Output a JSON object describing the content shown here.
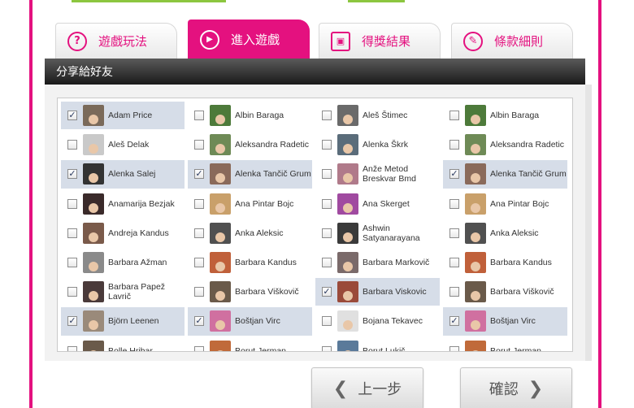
{
  "tabs": [
    {
      "label": "遊戲玩法",
      "icon": "question-icon",
      "glyph": "?"
    },
    {
      "label": "進入遊戲",
      "icon": "play-icon",
      "glyph": "▶",
      "active": true
    },
    {
      "label": "得獎結果",
      "icon": "gift-icon",
      "glyph": "▣"
    },
    {
      "label": "條款細則",
      "icon": "pencil-icon",
      "glyph": "✎"
    }
  ],
  "panel": {
    "title": "分享給好友"
  },
  "friends": [
    {
      "name": "Adam Price",
      "checked": true,
      "color": "#7a6a5a"
    },
    {
      "name": "Albin Baraga",
      "checked": false,
      "color": "#4d7a3a"
    },
    {
      "name": "Aleš Štimec",
      "checked": false,
      "color": "#6a6a6a"
    },
    {
      "name": "Albin Baraga",
      "checked": false,
      "color": "#4d7a3a"
    },
    {
      "name": "Aleš Delak",
      "checked": false,
      "color": "#c9c9c9"
    },
    {
      "name": "Aleksandra Radetic",
      "checked": false,
      "color": "#6e8a56"
    },
    {
      "name": "Alenka Škrk",
      "checked": false,
      "color": "#5a6c7a"
    },
    {
      "name": "Aleksandra Radetic",
      "checked": false,
      "color": "#6e8a56"
    },
    {
      "name": "Alenka Salej",
      "checked": true,
      "color": "#333333"
    },
    {
      "name": "Alenka Tančič Grum",
      "checked": true,
      "color": "#8a6a5a"
    },
    {
      "name": "Anže Metod Breskvar Bmd",
      "checked": false,
      "color": "#b07a8a"
    },
    {
      "name": "Alenka Tančič Grum",
      "checked": true,
      "color": "#8a6a5a"
    },
    {
      "name": "Anamarija Bezjak",
      "checked": false,
      "color": "#3a2a2a"
    },
    {
      "name": "Ana Pintar Bojc",
      "checked": false,
      "color": "#c9a06a"
    },
    {
      "name": "Ana Skerget",
      "checked": false,
      "color": "#a04aa0"
    },
    {
      "name": "Ana Pintar Bojc",
      "checked": false,
      "color": "#c9a06a"
    },
    {
      "name": "Andreja Kandus",
      "checked": false,
      "color": "#7a5a4a"
    },
    {
      "name": "Anka Aleksic",
      "checked": false,
      "color": "#505050"
    },
    {
      "name": "Ashwin Satyanarayana",
      "checked": false,
      "color": "#3a3a3a"
    },
    {
      "name": "Anka Aleksic",
      "checked": false,
      "color": "#505050"
    },
    {
      "name": "Barbara Ažman",
      "checked": false,
      "color": "#8a8a8a"
    },
    {
      "name": "Barbara Kandus",
      "checked": false,
      "color": "#c0603a"
    },
    {
      "name": "Barbara Markovič",
      "checked": false,
      "color": "#7a6a6a"
    },
    {
      "name": "Barbara Kandus",
      "checked": false,
      "color": "#c0603a"
    },
    {
      "name": "Barbara Papež Lavrič",
      "checked": false,
      "color": "#4a3a3a"
    },
    {
      "name": "Barbara Viškovič",
      "checked": false,
      "color": "#6a5a4a"
    },
    {
      "name": "Barbara Viskovic",
      "checked": true,
      "color": "#9a4a3a"
    },
    {
      "name": "Barbara Viškovič",
      "checked": false,
      "color": "#6a5a4a"
    },
    {
      "name": "Björn Leenen",
      "checked": true,
      "color": "#9a8a7a"
    },
    {
      "name": "Boštjan Virc",
      "checked": true,
      "color": "#d070a0"
    },
    {
      "name": "Bojana Tekavec",
      "checked": false,
      "color": "#e0e0e0"
    },
    {
      "name": "Boštjan Virc",
      "checked": true,
      "color": "#d070a0"
    },
    {
      "name": "Bolle Hribar",
      "checked": false,
      "color": "#6a5a4a"
    },
    {
      "name": "Borut Jerman",
      "checked": false,
      "color": "#c06a3a"
    },
    {
      "name": "Borut Lukič",
      "checked": false,
      "color": "#5a7a9a"
    },
    {
      "name": "Borut Jerman",
      "checked": false,
      "color": "#c06a3a"
    }
  ],
  "buttons": {
    "prev": "上一步",
    "confirm": "確認"
  }
}
